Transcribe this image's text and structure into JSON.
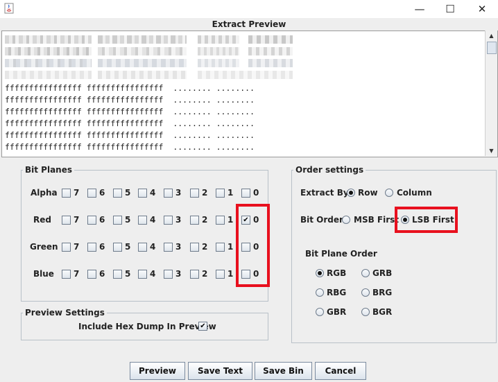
{
  "window": {
    "title": "Extract Preview",
    "controls": {
      "minimize": "—",
      "maximize": "☐",
      "close": "✕"
    }
  },
  "preview": {
    "hex_lines": [
      "ffffffffffffffff ffffffffffffffff  ........ ........",
      "ffffffffffffffff ffffffffffffffff  ........ ........",
      "ffffffffffffffff ffffffffffffffff  ........ ........",
      "ffffffffffffffff ffffffffffffffff  ........ ........",
      "ffffffffffffffff ffffffffffffffff  ........ ........",
      "ffffffffffffffff ffffffffffffffff  ........ ........"
    ]
  },
  "bit_planes": {
    "title": "Bit Planes",
    "bits": [
      "7",
      "6",
      "5",
      "4",
      "3",
      "2",
      "1",
      "0"
    ],
    "rows": [
      {
        "label": "Alpha",
        "checked_bits": []
      },
      {
        "label": "Red",
        "checked_bits": [
          "0"
        ]
      },
      {
        "label": "Green",
        "checked_bits": []
      },
      {
        "label": "Blue",
        "checked_bits": []
      }
    ]
  },
  "order_settings": {
    "title": "Order settings",
    "extract_by": {
      "label": "Extract By",
      "options": [
        "Row",
        "Column"
      ],
      "selected": "Row"
    },
    "bit_order": {
      "label": "Bit Order",
      "options": [
        "MSB First",
        "LSB First"
      ],
      "selected": "LSB First"
    },
    "bit_plane_order": {
      "label": "Bit Plane Order",
      "options": [
        "RGB",
        "GRB",
        "RBG",
        "BRG",
        "GBR",
        "BGR"
      ],
      "selected": "RGB"
    }
  },
  "preview_settings": {
    "title": "Preview Settings",
    "include_hex_label": "Include Hex Dump In Preview",
    "include_hex_checked": true
  },
  "buttons": {
    "preview": "Preview",
    "save_text": "Save Text",
    "save_bin": "Save Bin",
    "cancel": "Cancel"
  },
  "colors": {
    "highlight": "#e8101e",
    "background": "#eeeeee"
  }
}
